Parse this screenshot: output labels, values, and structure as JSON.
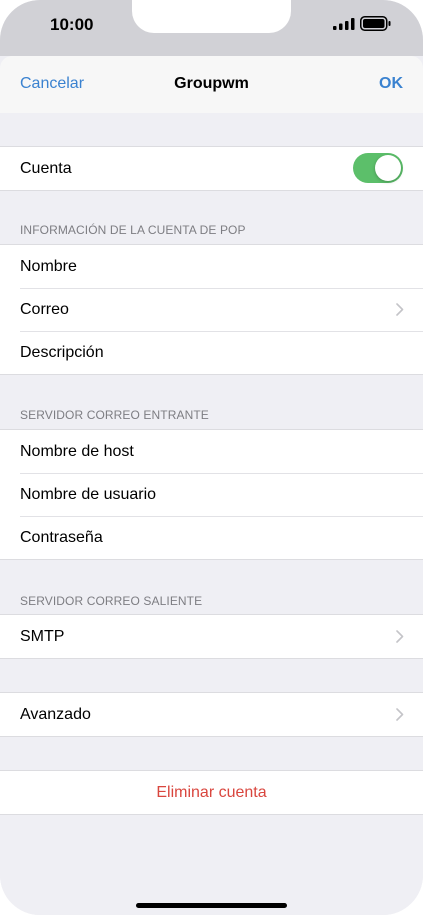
{
  "status_bar": {
    "time": "10:00"
  },
  "nav": {
    "cancel_label": "Cancelar",
    "title": "Groupwm",
    "ok_label": "OK"
  },
  "account": {
    "label": "Cuenta",
    "enabled": true
  },
  "pop_section": {
    "header": "INFORMACIÓN DE LA CUENTA DE POP",
    "rows": [
      "Nombre",
      "Correo",
      "Descripción"
    ]
  },
  "incoming_section": {
    "header": "SERVIDOR CORREO ENTRANTE",
    "rows": [
      "Nombre de host",
      "Nombre de usuario",
      "Contraseña"
    ]
  },
  "outgoing_section": {
    "header": "SERVIDOR CORREO SALIENTE",
    "rows": [
      "SMTP"
    ]
  },
  "advanced": {
    "label": "Avanzado"
  },
  "delete": {
    "label": "Eliminar cuenta"
  },
  "colors": {
    "accent": "#3a82d0",
    "toggle_on": "#5cbf6a",
    "destructive": "#d9463e"
  },
  "icons": [
    "signal-icon",
    "battery-icon",
    "chevron-right-icon"
  ]
}
